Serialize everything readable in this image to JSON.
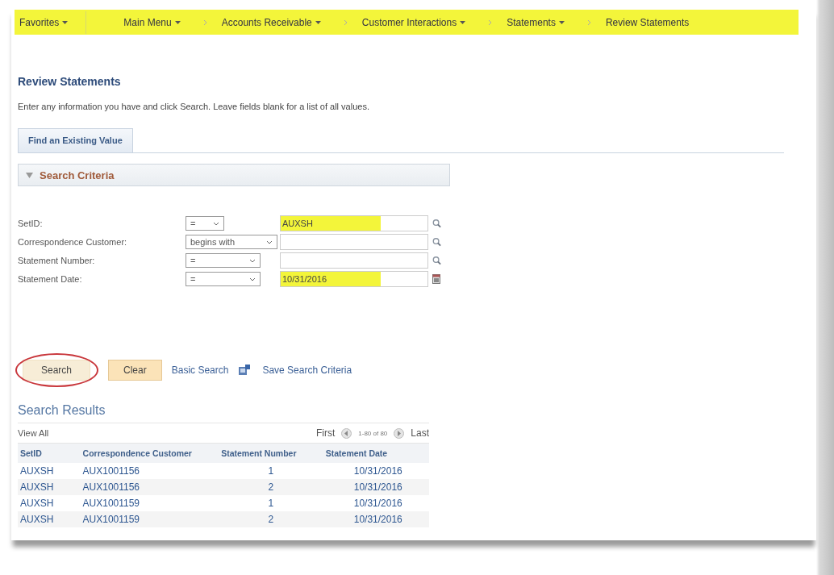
{
  "breadcrumbs": {
    "highlighted": true,
    "items": [
      {
        "label": "Favorites",
        "has_menu": true
      },
      {
        "label": "Main Menu",
        "has_menu": true
      },
      {
        "label": "Accounts Receivable",
        "has_menu": true
      },
      {
        "label": "Customer Interactions",
        "has_menu": true
      },
      {
        "label": "Statements",
        "has_menu": true
      },
      {
        "label": "Review Statements",
        "has_menu": false
      }
    ]
  },
  "page_title": "Review Statements",
  "instructions": "Enter any information you have and click Search. Leave fields blank for a list of all values.",
  "tabs": [
    {
      "label": "Find an Existing Value",
      "selected": true
    }
  ],
  "search_criteria": {
    "title": "Search Criteria",
    "expanded": true,
    "fields": [
      {
        "label": "SetID:",
        "operator": "=",
        "value": "AUXSH",
        "highlighted": true,
        "kind": "lookup"
      },
      {
        "label": "Correspondence Customer:",
        "operator": "begins with",
        "highlighted": false,
        "kind": "lookup"
      },
      {
        "label": "Statement Number:",
        "operator": "=",
        "highlighted": false,
        "kind": "lookup"
      },
      {
        "label": "Statement Date:",
        "operator": "=",
        "value": "10/31/2016",
        "highlighted": true,
        "kind": "date"
      }
    ]
  },
  "buttons": [
    {
      "label": "Search",
      "circled": true
    },
    {
      "label": "Clear",
      "circled": false
    }
  ],
  "links": [
    {
      "label": "Basic Search",
      "kind": "link"
    },
    {
      "label": "Save Search Criteria",
      "kind": "icon-link"
    }
  ],
  "results": {
    "title": "Search Results",
    "view_all": "View All",
    "first": "First",
    "range": "1-80 of 80",
    "last": "Last",
    "columns": [
      "SetID",
      "Correspondence Customer",
      "Statement Number",
      "Statement Date"
    ],
    "rows": [
      [
        "AUXSH",
        "AUX1001156",
        "1",
        "10/31/2016"
      ],
      [
        "AUXSH",
        "AUX1001156",
        "2",
        "10/31/2016"
      ],
      [
        "AUXSH",
        "AUX1001159",
        "1",
        "10/31/2016"
      ],
      [
        "AUXSH",
        "AUX1001159",
        "2",
        "10/31/2016"
      ]
    ]
  }
}
